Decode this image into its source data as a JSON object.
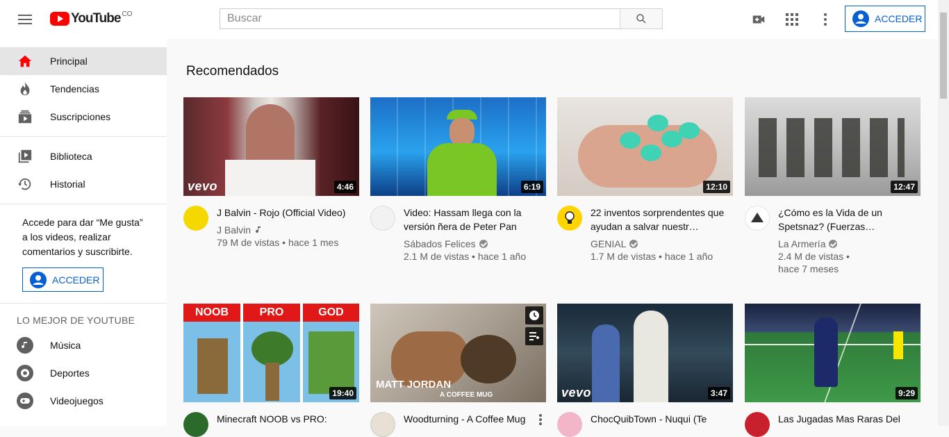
{
  "header": {
    "logo_text": "YouTube",
    "logo_country": "CO",
    "search_placeholder": "Buscar",
    "signin_label": "ACCEDER"
  },
  "sidebar": {
    "items": [
      {
        "label": "Principal"
      },
      {
        "label": "Tendencias"
      },
      {
        "label": "Suscripciones"
      },
      {
        "label": "Biblioteca"
      },
      {
        "label": "Historial"
      }
    ],
    "signin_text": "Accede para dar “Me gusta” a los videos, realizar comentarios y suscribirte.",
    "signin_label": "ACCEDER",
    "best_title": "LO MEJOR DE YOUTUBE",
    "best_items": [
      {
        "label": "Música"
      },
      {
        "label": "Deportes"
      },
      {
        "label": "Videojuegos"
      }
    ]
  },
  "main": {
    "title": "Recomendados",
    "videos": [
      {
        "title": "J Balvin - Rojo (Official Video)",
        "channel": "J Balvin",
        "stats": "79 M de vistas • hace 1 mes",
        "duration": "4:46",
        "logo": "vevo"
      },
      {
        "title": "Video: Hassam llega con la versión ñera de Peter Pan",
        "channel": "Sábados Felices",
        "stats": "2.1 M de vistas • hace 1 año",
        "duration": "6:19"
      },
      {
        "title": "22 inventos sorprendentes que ayudan a salvar nuestr…",
        "channel": "GENIAL",
        "stats": "1.7 M de vistas • hace 1 año",
        "duration": "12:10"
      },
      {
        "title": "¿Cómo es la Vida de un Spetsnaz? (Fuerzas…",
        "channel": "La Armería",
        "stats": "2.4 M de vistas •",
        "stats2": "hace 7 meses",
        "duration": "12:47"
      },
      {
        "title": "Minecraft NOOB vs PRO:",
        "duration": "19:40",
        "labels": [
          "NOOB",
          "PRO",
          "GOD"
        ]
      },
      {
        "title": "Woodturning - A Coffee Mug",
        "duration": "",
        "caption1": "MATT JORDAN",
        "caption2": "A COFFEE MUG"
      },
      {
        "title": "ChocQuibTown - Nuqui (Te",
        "duration": "3:47",
        "logo": "vevo"
      },
      {
        "title": "Las Jugadas Mas Raras Del",
        "duration": "9:29"
      }
    ]
  },
  "colors": {
    "brand": "#ff0000",
    "link": "#065fd4"
  }
}
